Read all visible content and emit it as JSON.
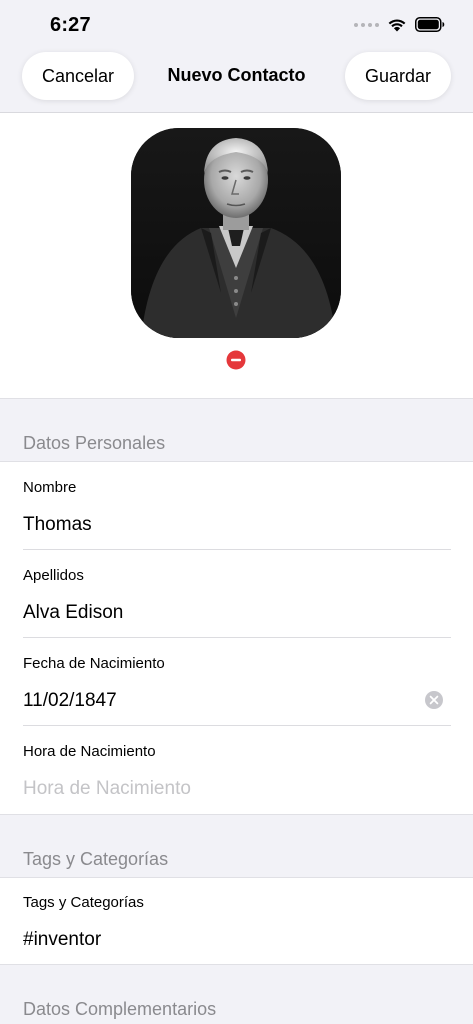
{
  "status_bar": {
    "time": "6:27"
  },
  "nav": {
    "cancel_label": "Cancelar",
    "title": "Nuevo Contacto",
    "save_label": "Guardar"
  },
  "colors": {
    "background": "#f2f2f7",
    "remove_red": "#e5383b",
    "secondary_text": "#8a8a8e",
    "placeholder_text": "#c4c4c7"
  },
  "sections": {
    "personal": {
      "header": "Datos Personales",
      "fields": [
        {
          "label": "Nombre",
          "value": "Thomas"
        },
        {
          "label": "Apellidos",
          "value": "Alva Edison"
        },
        {
          "label": "Fecha de Nacimiento",
          "value": "11/02/1847"
        },
        {
          "label": "Hora de Nacimiento",
          "placeholder": "Hora de Nacimiento"
        }
      ]
    },
    "tags": {
      "header": "Tags y Categorías",
      "fields": [
        {
          "label": "Tags y Categorías",
          "value": "#inventor"
        }
      ]
    },
    "extra": {
      "header": "Datos Complementarios"
    }
  },
  "icons": {
    "cell": "cellular-signal-icon",
    "wifi": "wifi-icon",
    "battery": "battery-icon",
    "remove": "remove-photo-icon",
    "clear": "clear-field-icon"
  }
}
